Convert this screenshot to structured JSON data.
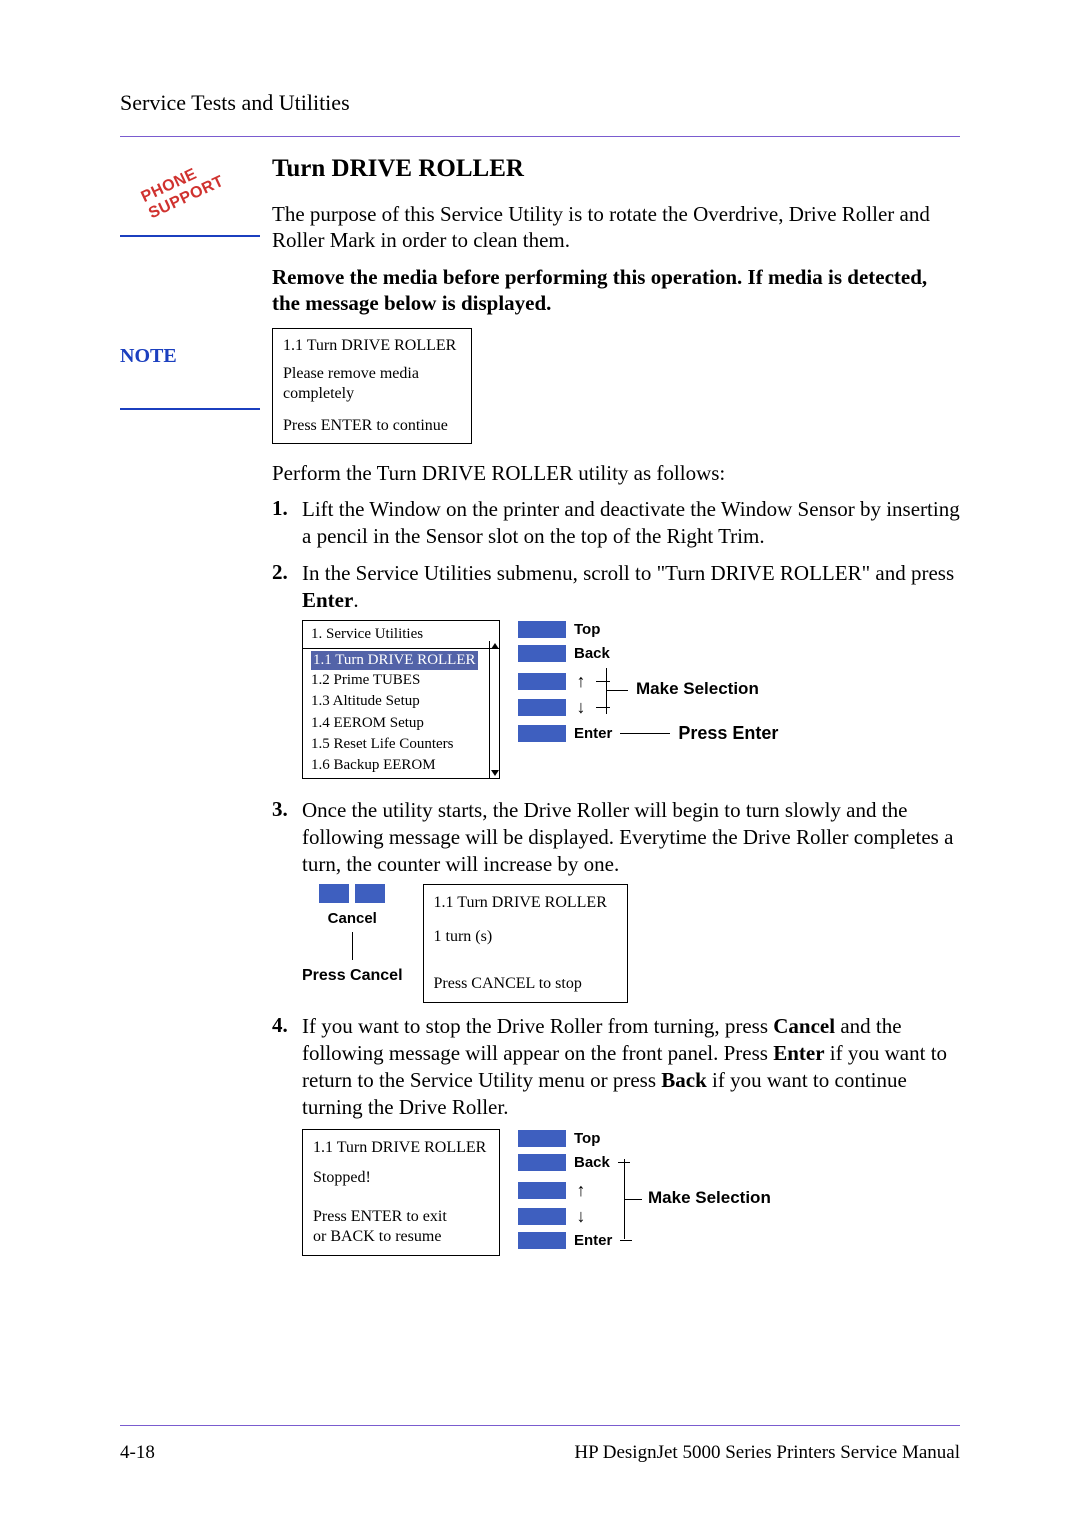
{
  "header": {
    "running": "Service Tests and Utilities"
  },
  "sidebar": {
    "phone_support": "PHONE SUPPORT",
    "note_label": "NOTE"
  },
  "main": {
    "title": "Turn DRIVE ROLLER",
    "intro": "The purpose of this Service Utility is to rotate the Overdrive, Drive Roller and Roller Mark in order to clean them.",
    "note_bold": "Remove the media before performing this operation. If media is detected, the message below is displayed.",
    "panel1": {
      "title": "1.1 Turn DRIVE ROLLER",
      "line1": "Please remove media",
      "line2": "completely",
      "bottom": "Press ENTER to continue"
    },
    "perform": "Perform the Turn DRIVE ROLLER utility as follows:",
    "steps": {
      "1": "Lift the Window on the printer and deactivate the Window Sensor by inserting a pencil in the Sensor slot on the top of the Right Trim.",
      "2_a": "In the Service Utilities submenu, scroll to \"Turn DRIVE ROLLER\" and press ",
      "2_b": "Enter",
      "2_c": ".",
      "3": "Once the utility starts, the Drive Roller will begin to turn slowly and the following message will be displayed. Everytime the Drive Roller completes a turn, the counter will increase by one.",
      "4_a": "If you want to stop the Drive Roller from turning, press ",
      "4_cancel": "Cancel",
      "4_b": " and the following message will appear on the front panel. Press ",
      "4_enter": "Enter",
      "4_c": " if you want to return to the Service Utility menu or press ",
      "4_back": "Back",
      "4_d": " if you want to continue turning the Drive Roller."
    },
    "menu1": {
      "header": "1. Service Utilities",
      "items": [
        "1.1 Turn DRIVE ROLLER",
        "1.2 Prime TUBES",
        "1.3 Altitude Setup",
        "1.4 EEROM Setup",
        "1.5 Reset Life Counters",
        "1.6 Backup EEROM"
      ]
    },
    "nav": {
      "top": "Top",
      "back": "Back",
      "up": "↑",
      "down": "↓",
      "enter": "Enter",
      "make_selection": "Make Selection",
      "press_enter": "Press Enter"
    },
    "cancel_block": {
      "cancel": "Cancel",
      "press_cancel": "Press Cancel"
    },
    "panel2": {
      "title": "1.1 Turn DRIVE ROLLER",
      "mid": "1 turn (s)",
      "bottom": "Press CANCEL to stop"
    },
    "panel3": {
      "title": "1.1 Turn DRIVE ROLLER",
      "mid": "Stopped!",
      "bottom1": "Press ENTER to exit",
      "bottom2": "or BACK to resume"
    }
  },
  "footer": {
    "page": "4-18",
    "manual": "HP DesignJet 5000 Series Printers Service Manual"
  }
}
